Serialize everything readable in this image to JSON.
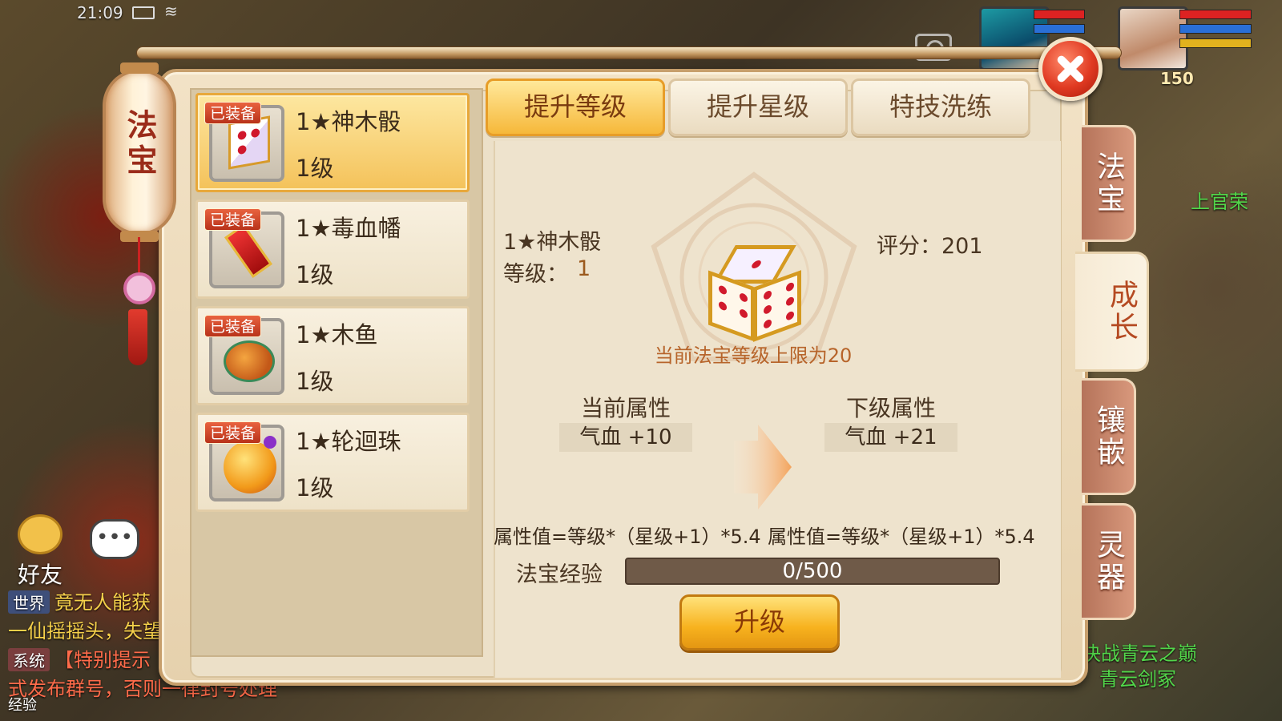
{
  "status_bar": {
    "time": "21:09"
  },
  "hud": {
    "portrait_level": "150",
    "npc_names": [
      "上官荣",
      "决战青云之巅",
      "青云剑冢"
    ],
    "friend_label": "好友",
    "chat_lines": [
      {
        "channel": "世界",
        "text": "竟无人能获"
      },
      {
        "channel": "",
        "text": "一仙摇摇头，失望"
      },
      {
        "channel": "系统",
        "text": "【特别提示"
      },
      {
        "channel": "",
        "text": "式发布群号，否则一律封号处理"
      },
      {
        "channel": "",
        "text": "经验"
      }
    ]
  },
  "dialog": {
    "title": "法宝",
    "side_tabs": [
      "法宝",
      "成长",
      "镶嵌",
      "灵器"
    ],
    "active_side_tab": "成长",
    "top_tabs": [
      "提升等级",
      "提升星级",
      "特技洗练"
    ],
    "active_top_tab": "提升等级",
    "items": [
      {
        "badge": "已装备",
        "name": "1★神木骰",
        "level": "1级",
        "selected": true,
        "icon": "dice-icon"
      },
      {
        "badge": "已装备",
        "name": "1★毒血幡",
        "level": "1级",
        "selected": false,
        "icon": "banner-icon"
      },
      {
        "badge": "已装备",
        "name": "1★木鱼",
        "level": "1级",
        "selected": false,
        "icon": "wooden-fish-icon"
      },
      {
        "badge": "已装备",
        "name": "1★轮迴珠",
        "level": "1级",
        "selected": false,
        "icon": "pearl-icon"
      }
    ],
    "detail": {
      "name": "1★神木骰",
      "level_label": "等级：",
      "level_value": "1",
      "score": "评分：201",
      "cap_text": "当前法宝等级上限为20",
      "current_attr_title": "当前属性",
      "current_attr_value": "气血 +10",
      "next_attr_title": "下级属性",
      "next_attr_value": "气血 +21",
      "formula_current": "属性值=等级*（星级+1）*5.4",
      "formula_next": "属性值=等级*（星级+1）*5.4",
      "exp_label": "法宝经验",
      "exp_text": "0/500",
      "exp_progress": 0,
      "upgrade_button": "升级"
    }
  },
  "colors": {
    "accent_gold": "#f6b83a",
    "close_red": "#e03a22",
    "side_tab_brown": "#c4826a",
    "npc_name_green": "#52d64a"
  }
}
